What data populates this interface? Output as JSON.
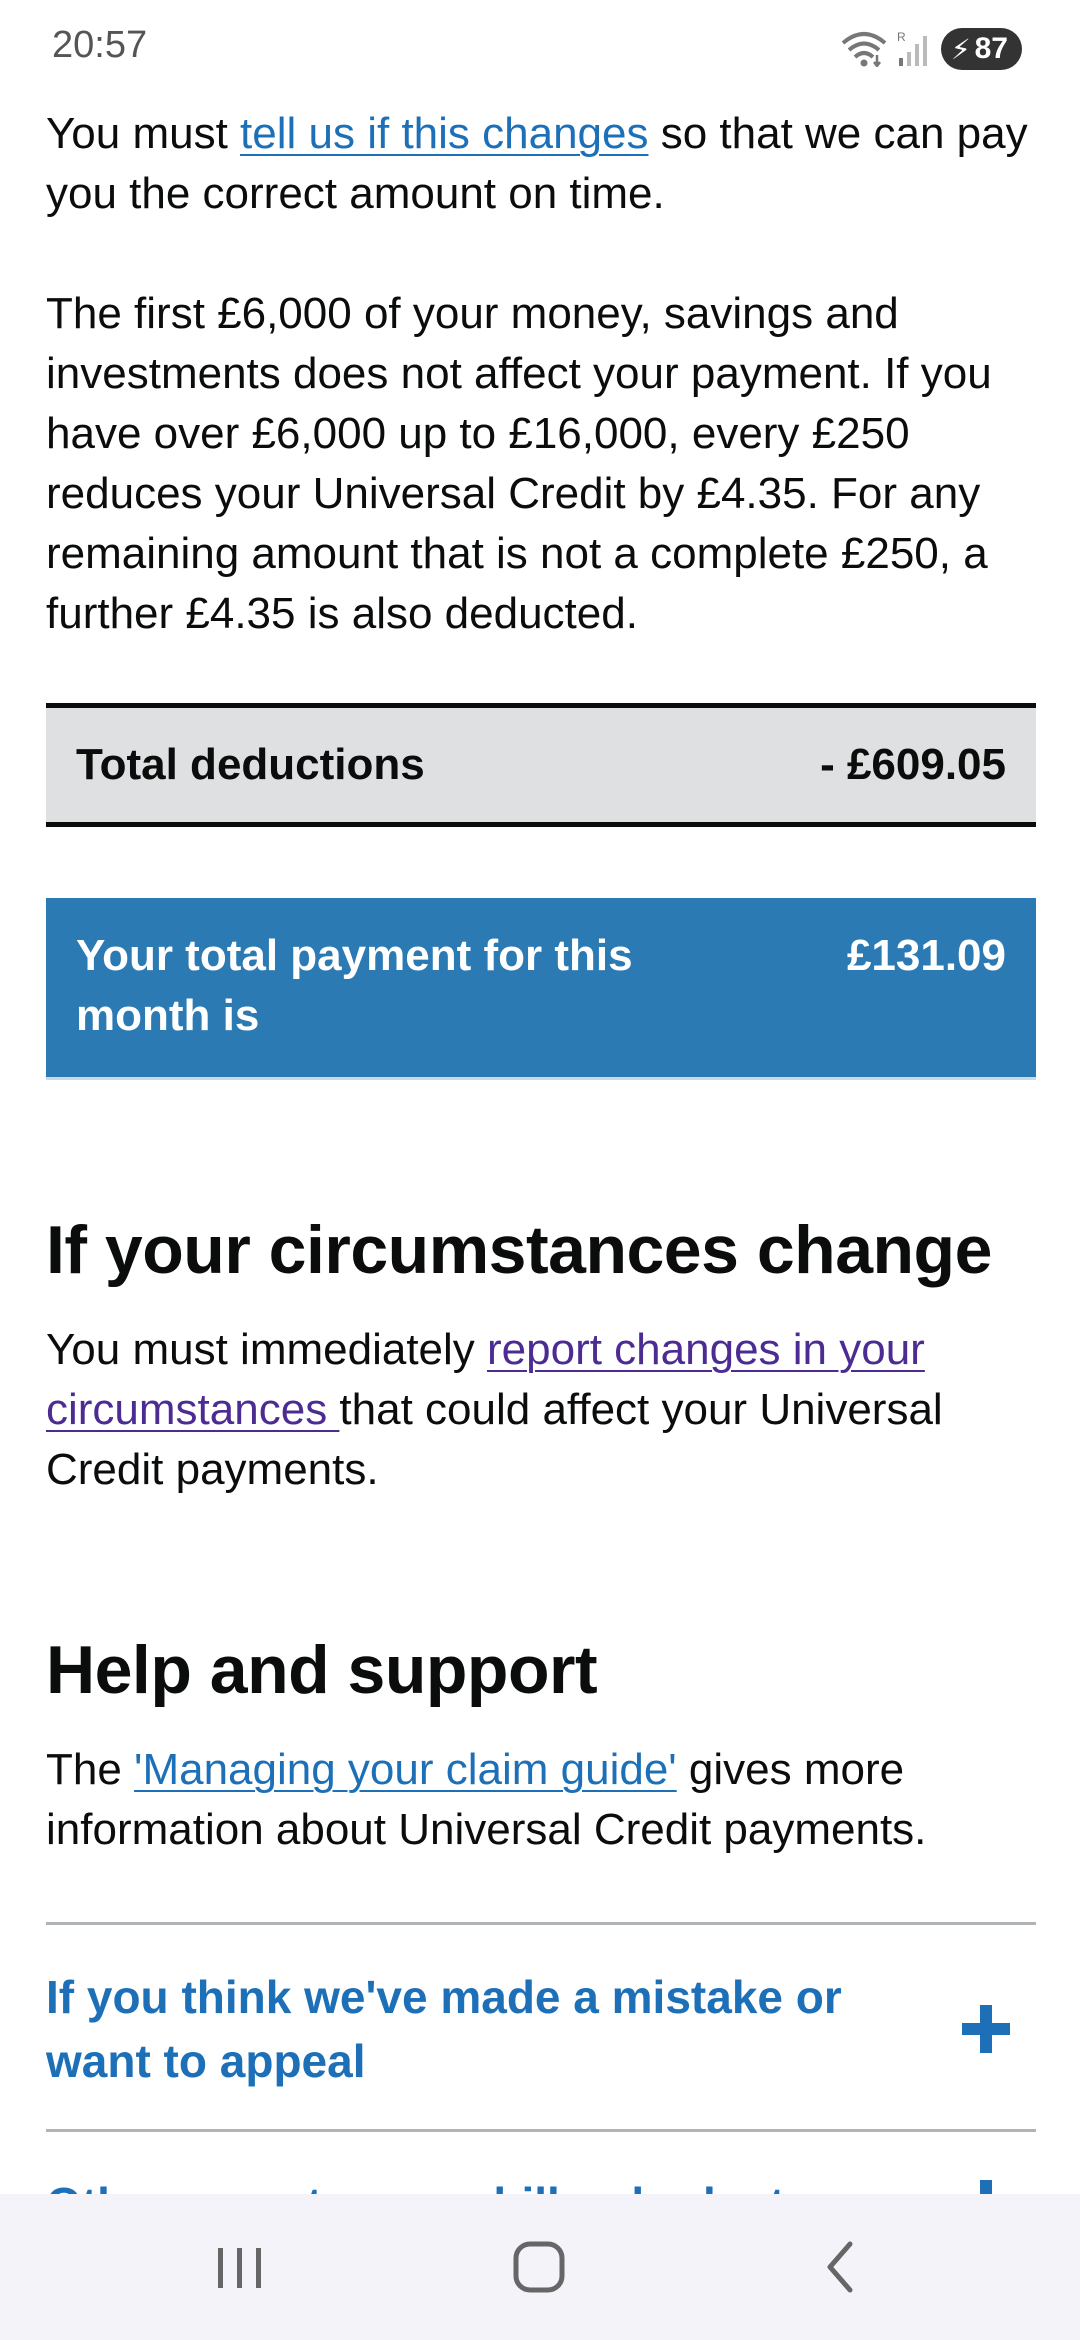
{
  "status_bar": {
    "time": "20:57",
    "wifi_icon": "wifi-icon",
    "roaming_label": "R",
    "signal_icon": "signal-icon",
    "battery_level": "87",
    "battery_charging": true
  },
  "content": {
    "para1": {
      "before": "You must ",
      "link": "tell us if this changes",
      "after": " so that we can pay you the correct amount on time."
    },
    "para2": "The first £6,000 of your money, savings and investments does not affect your payment. If you have over £6,000 up to £16,000, every £250 reduces your Universal Credit by £4.35. For any remaining amount that is not a complete £250, a further £4.35 is also deducted.",
    "total_deductions": {
      "label": "Total deductions",
      "value": "- £609.05"
    },
    "total_payment": {
      "label": "Your total payment for this month is",
      "value": "£131.09",
      "color": "#2b7ab3"
    },
    "circumstances": {
      "heading": "If your circumstances change",
      "before": "You must immediately ",
      "link": "report changes in your circumstances ",
      "after": "that could affect your Universal Credit payments."
    },
    "help": {
      "heading": "Help and support",
      "before": "The ",
      "link": "'Managing your claim guide'",
      "after": " gives more information about Universal Credit payments."
    },
    "accordion": [
      {
        "title": "If you think we've made a mistake or want to appeal",
        "icon": "plus-icon"
      },
      {
        "title": "Other ways to pay a bill or budget",
        "icon": "plus-icon"
      }
    ]
  },
  "nav_bar": {
    "recent_icon": "recent-apps-icon",
    "home_icon": "home-icon",
    "back_icon": "back-icon"
  },
  "colors": {
    "link": "#1d70b8",
    "visited_link": "#4c2c92",
    "payment_panel": "#2b7ab3",
    "deductions_panel": "#dfe0e1"
  }
}
